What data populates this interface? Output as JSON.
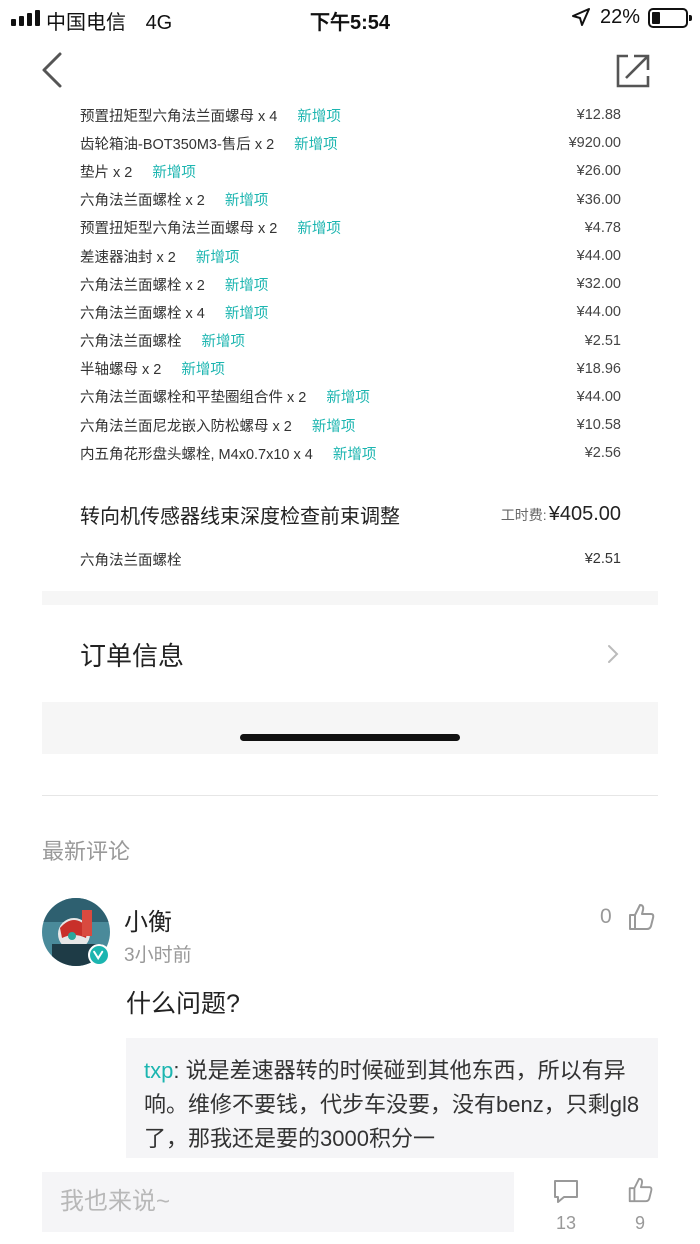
{
  "status_bar": {
    "carrier": "中国电信",
    "network": "4G",
    "time": "下午5:54",
    "battery": "22%"
  },
  "nav": {
    "back_icon": "chevron-left-icon",
    "share_icon": "share-out-icon"
  },
  "parts": [
    {
      "name": "预置扭矩型六角法兰面螺母 x 4",
      "tag": "新增项",
      "price": "¥12.88"
    },
    {
      "name": "齿轮箱油-BOT350M3-售后 x 2",
      "tag": "新增项",
      "price": "¥920.00"
    },
    {
      "name": "垫片 x 2",
      "tag": "新增项",
      "price": "¥26.00"
    },
    {
      "name": "六角法兰面螺栓 x 2",
      "tag": "新增项",
      "price": "¥36.00"
    },
    {
      "name": "预置扭矩型六角法兰面螺母 x 2",
      "tag": "新增项",
      "price": "¥4.78"
    },
    {
      "name": "差速器油封 x 2",
      "tag": "新增项",
      "price": "¥44.00"
    },
    {
      "name": "六角法兰面螺栓 x 2",
      "tag": "新增项",
      "price": "¥32.00"
    },
    {
      "name": "六角法兰面螺栓 x 4",
      "tag": "新增项",
      "price": "¥44.00"
    },
    {
      "name": "六角法兰面螺栓",
      "tag": "新增项",
      "price": "¥2.51"
    },
    {
      "name": "半轴螺母 x 2",
      "tag": "新增项",
      "price": "¥18.96"
    },
    {
      "name": "六角法兰面螺栓和平垫圈组合件 x 2",
      "tag": "新增项",
      "price": "¥44.00"
    },
    {
      "name": "六角法兰面尼龙嵌入防松螺母 x 2",
      "tag": "新增项",
      "price": "¥10.58"
    },
    {
      "name": "内五角花形盘头螺栓, M4x0.7x10 x 4",
      "tag": "新增项",
      "price": "¥2.56"
    }
  ],
  "service": {
    "title": "转向机传感器线束深度检查前束调整",
    "fee_label": "工时费:",
    "fee_value": "¥405.00",
    "part_name": "六角法兰面螺栓",
    "part_price": "¥2.51"
  },
  "order_info": {
    "label": "订单信息"
  },
  "comments_section": {
    "title": "最新评论"
  },
  "comment": {
    "user": "小衡",
    "time": "3小时前",
    "likes": "0",
    "text": "什么问题?",
    "quote_author": "txp",
    "quote_sep": ": ",
    "quote_text": "说是差速器转的时候碰到其他东西，所以有异响。维修不要钱，代步车没要，没有benz，只剩gl8了，那我还是要的3000积分一"
  },
  "bottom_bar": {
    "input_placeholder": "我也来说~",
    "comment_count": "13",
    "like_count": "9"
  },
  "colors": {
    "accent": "#1cb5b0",
    "panel": "#f5f5f7"
  }
}
